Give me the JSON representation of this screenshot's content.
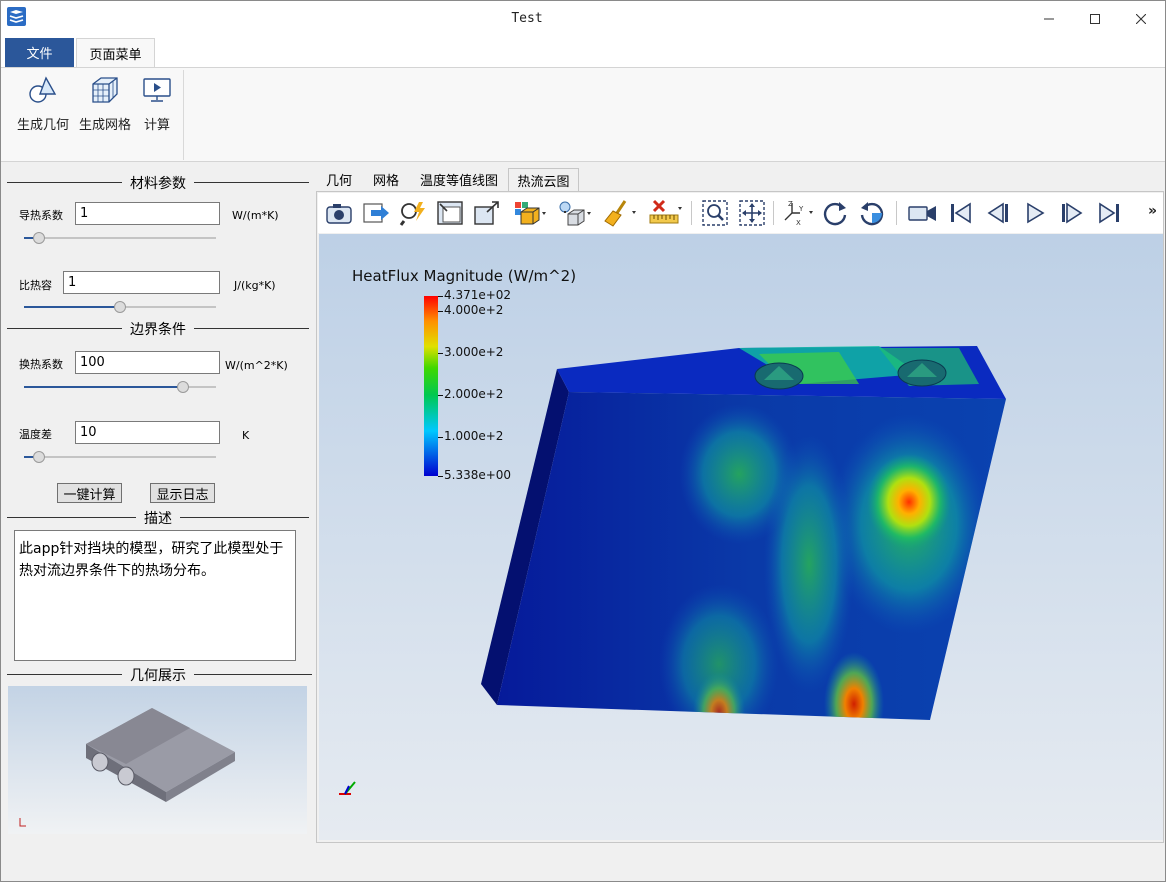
{
  "window": {
    "title": "Test"
  },
  "ribbon": {
    "tabs": [
      "文件",
      "页面菜单"
    ],
    "buttons": [
      {
        "label": "生成几何",
        "icon": "shapes-icon"
      },
      {
        "label": "生成网格",
        "icon": "mesh-cube-icon"
      },
      {
        "label": "计算",
        "icon": "monitor-play-icon"
      }
    ]
  },
  "left": {
    "material": {
      "title": "材料参数",
      "conductivity": {
        "label": "导热系数",
        "value": "1",
        "unit": "W/(m*K)",
        "slider_fraction": 0.05
      },
      "heat_capacity": {
        "label": "比热容",
        "value": "1",
        "unit": "J/(kg*K)",
        "slider_fraction": 0.5
      }
    },
    "boundary": {
      "title": "边界条件",
      "htc": {
        "label": "换热系数",
        "value": "100",
        "unit": "W/(m^2*K)",
        "slider_fraction": 0.85
      },
      "temp_diff": {
        "label": "温度差",
        "value": "10",
        "unit": "K",
        "slider_fraction": 0.05
      }
    },
    "actions": {
      "compute": "一键计算",
      "log": "显示日志"
    },
    "description": {
      "title": "描述",
      "text": "此app针对挡块的模型，研究了此模型处于热对流边界条件下的热场分布。"
    },
    "geometry": {
      "title": "几何展示"
    }
  },
  "view": {
    "tabs": [
      "几何",
      "网格",
      "温度等值线图",
      "热流云图"
    ],
    "active_tab": "热流云图",
    "toolbar": [
      "camera-icon",
      "export-arrow-icon",
      "magnify-lightning-icon",
      "fit-box-icon",
      "scale-box-icon",
      "colored-cube-icon",
      "light-cube-icon",
      "broom-icon",
      "remove-ruler-icon",
      "zoom-window-icon",
      "fit-all-icon",
      "axes-icon",
      "rotate-cw-icon",
      "rotate-ccw-icon",
      "video-camera-icon",
      "first-frame-icon",
      "previous-frame-icon",
      "play-icon",
      "next-frame-icon",
      "last-frame-icon"
    ],
    "toolbar_more": "»"
  },
  "chart_data": {
    "type": "heatmap",
    "title": "HeatFlux Magnitude (W/m^2)",
    "range": [
      5.338,
      437.1
    ],
    "colormap": "rainbow (blue-cyan-green-yellow-red)",
    "tick_values": [
      437.1,
      400,
      300,
      200,
      100,
      5.338
    ],
    "tick_labels": [
      "4.371e+02",
      "4.000e+2",
      "3.000e+2",
      "2.000e+2",
      "1.000e+2",
      "5.338e+00"
    ]
  }
}
